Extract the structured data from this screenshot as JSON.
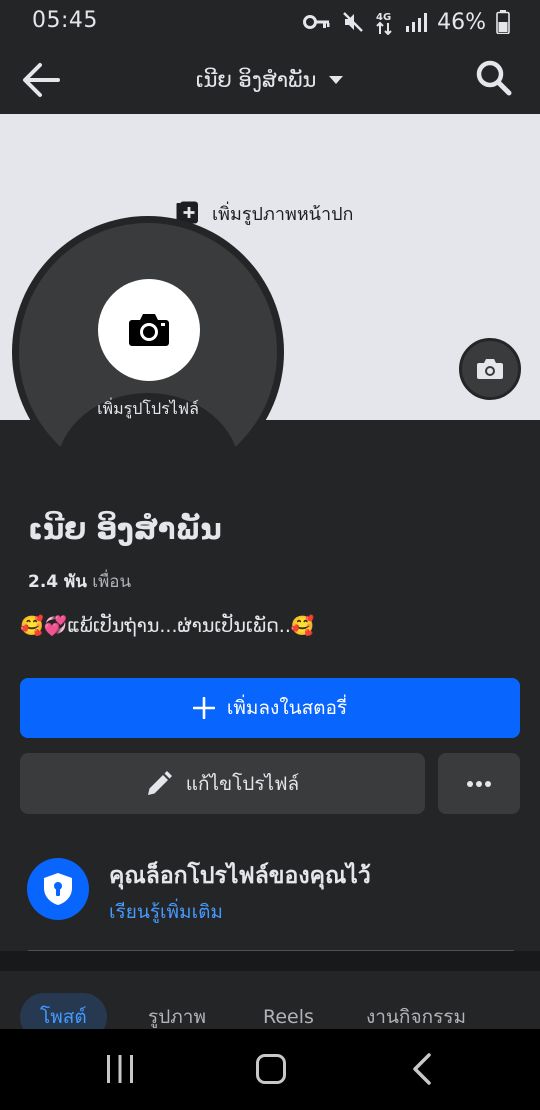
{
  "status_bar": {
    "time": "05:45",
    "battery_percent": "46%",
    "network": "4G",
    "icons": [
      "key-icon",
      "mute-icon",
      "network-4g-icon",
      "signal-icon",
      "battery-icon"
    ]
  },
  "top_nav": {
    "title": "ເນີຍ ອິງສຳພັນ",
    "icons": [
      "back-arrow-icon",
      "chevron-down-icon",
      "search-icon"
    ]
  },
  "cover": {
    "add_cover_label": "เพิ่มรูปภาพหน้าปก",
    "icons": [
      "add-photo-icon",
      "camera-icon"
    ]
  },
  "avatar": {
    "add_profile_label": "เพิ่มรูปโปรไฟล์"
  },
  "profile": {
    "name": "ເນີຍ ອິງສຳພັນ",
    "friends_count": "2.4 พัน",
    "friends_label": "เพื่อน",
    "bio": "🥰💞ແພ້ເປັນຖ່ານ...ຜ່ານເປັນເພັດ..🥰"
  },
  "actions": {
    "add_story_label": "เพิ่มลงในสตอรี่",
    "edit_profile_label": "แก้ไขโปรไฟล์",
    "icons": [
      "plus-icon",
      "pencil-icon",
      "more-icon"
    ]
  },
  "lock_notice": {
    "title": "คุณล็อกโปรไฟล์ของคุณไว้",
    "learn_more": "เรียนรู้เพิ่มเติม",
    "icon": "shield-lock-icon"
  },
  "tabs": [
    {
      "label": "โพสต์",
      "active": true
    },
    {
      "label": "รูปภาพ",
      "active": false
    },
    {
      "label": "Reels",
      "active": false
    },
    {
      "label": "งานกิจกรรม",
      "active": false
    }
  ],
  "android_nav": {
    "icons": [
      "recents-icon",
      "home-icon",
      "nav-back-icon"
    ]
  },
  "colors": {
    "background": "#242526",
    "primary": "#0866ff",
    "link": "#4599ff",
    "cover": "#e4e6eb",
    "button": "#3a3b3c"
  }
}
